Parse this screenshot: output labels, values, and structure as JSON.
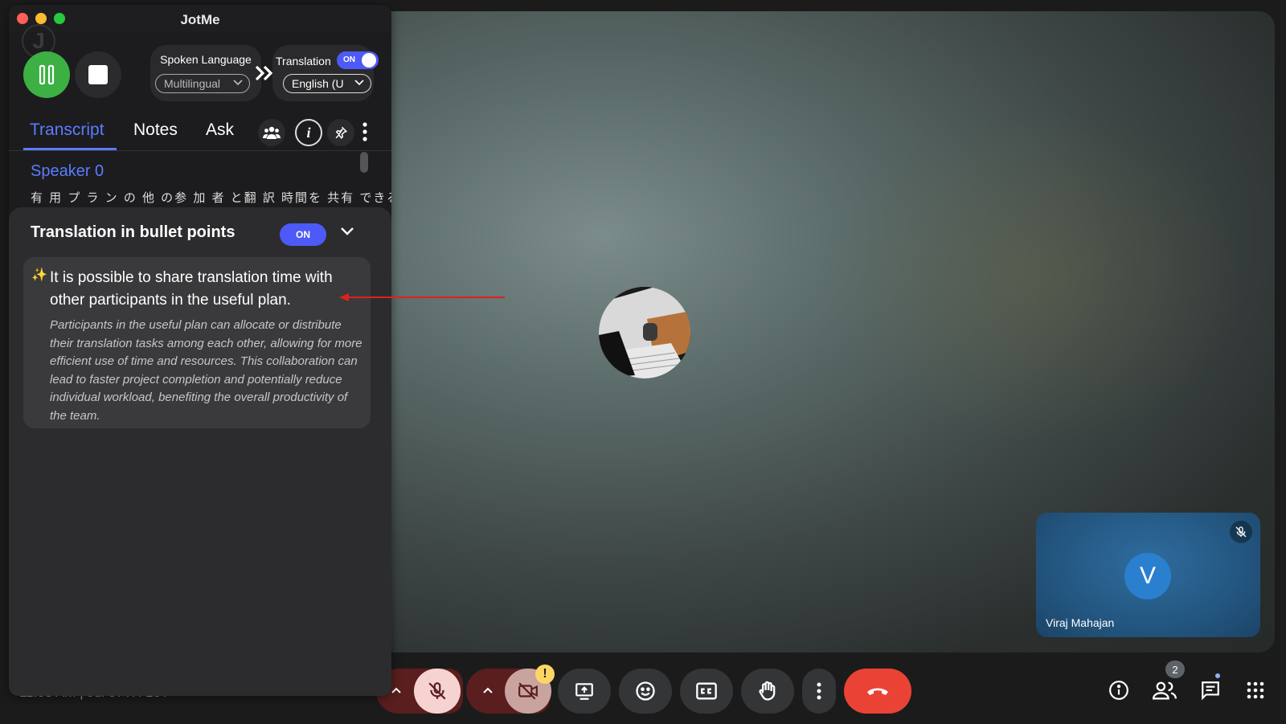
{
  "app": {
    "title": "JotMe",
    "logo_letter": "J"
  },
  "controls": {
    "spoken_language_label": "Spoken Language",
    "spoken_language_value": "Multilingual",
    "translation_label": "Translation",
    "translation_toggle": "ON",
    "translation_language_value": "English (U"
  },
  "tabs": [
    {
      "label": "Transcript",
      "active": true
    },
    {
      "label": "Notes",
      "active": false
    },
    {
      "label": "Ask",
      "active": false
    }
  ],
  "transcript": {
    "speaker": "Speaker 0",
    "line": "有 用 プ ラ ン の 他 の参 加 者 と翻 訳 時間を 共有 できる"
  },
  "bullets_panel": {
    "title": "Translation in bullet points",
    "toggle": "ON",
    "items": [
      {
        "headline": "It is possible to share translation time with other participants in the useful plan.",
        "detail": "Participants in the useful plan can allocate or distribute their translation tasks among each other, allowing for more efficient use of time and resources. This collaboration can lead to faster project completion and potentially reduce individual workload, benefiting the overall productivity of the team."
      }
    ]
  },
  "meet": {
    "self_tile": {
      "initial": "V",
      "name": "Viraj Mahajan"
    },
    "time_text": "11:08 AM | Jul 07TH 10T",
    "participants_count": "2"
  },
  "colors": {
    "accent": "#5b7cff",
    "toggle": "#4d5af7",
    "pause": "#3cb043",
    "end_call": "#ea4335"
  }
}
